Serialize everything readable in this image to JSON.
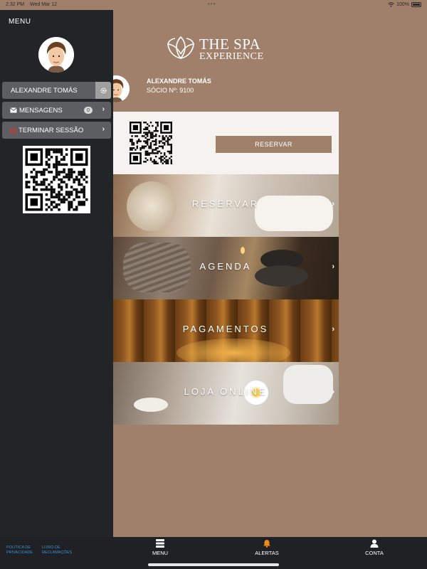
{
  "status_bar": {
    "time": "2:32 PM",
    "date": "Wed Mar 12",
    "battery": "100%"
  },
  "brand": {
    "line1": "THE SPA",
    "line2": "EXPERIENCE"
  },
  "member": {
    "name": "ALEXANDRE TOMÁS",
    "member_id": "SÓCIO Nº: 9100"
  },
  "booking_card": {
    "reserve_label": "RESERVAR"
  },
  "tiles": [
    {
      "label": "RESERVAR"
    },
    {
      "label": "AGENDA"
    },
    {
      "label": "PAGAMENTOS"
    },
    {
      "label": "LOJA ONLINE"
    }
  ],
  "sidemenu": {
    "title": "MENU",
    "user_label": "ALEXANDRE TOMÁS",
    "messages_label": "MENSAGENS",
    "messages_count": "0",
    "logout_label": "TERMINAR SESSÃO"
  },
  "footer": {
    "privacy_label": "POLÍTICA DE PRIVACIDADE",
    "complaints_label": "LIVRO DE RECLAMAÇÕES"
  },
  "tabs": {
    "menu": "MENU",
    "alerts": "ALERTAS",
    "account": "CONTA"
  },
  "icons": [
    "wifi-icon",
    "battery-icon",
    "lotus-logo-icon",
    "avatar-icon",
    "gear-icon",
    "envelope-icon",
    "power-icon",
    "chevron-right-icon",
    "qr-code-icon",
    "menu-stack-icon",
    "bell-icon",
    "user-icon"
  ],
  "colors": {
    "accent": "#a0806b",
    "sidebar": "#222528",
    "button": "#5c5e61",
    "alert_icon": "#f08a1c",
    "link": "#3c8fd6"
  }
}
